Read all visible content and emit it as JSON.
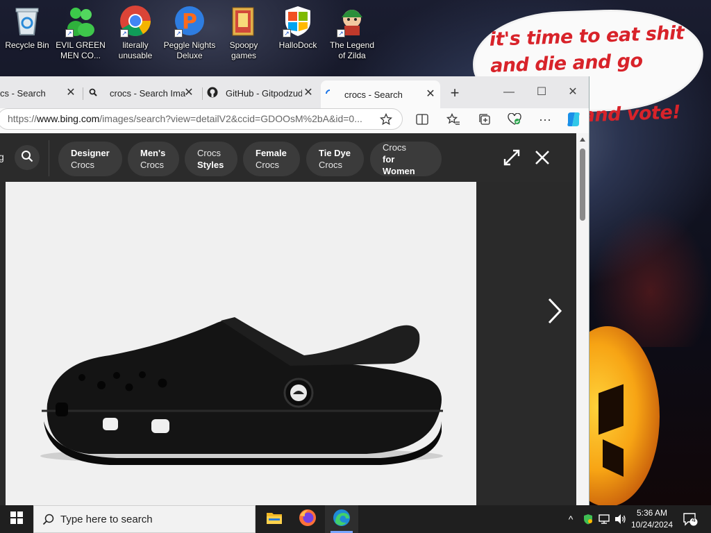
{
  "desktop": {
    "icons": [
      {
        "label": "Recycle Bin",
        "icon": "recycle-bin-icon",
        "shortcut": false
      },
      {
        "label": "EVIL GREEN MEN CO...",
        "icon": "evil-green-men-icon",
        "shortcut": true
      },
      {
        "label": "literally unusable",
        "icon": "chrome-icon",
        "shortcut": true
      },
      {
        "label": "Peggle Nights Deluxe",
        "icon": "peggle-icon",
        "shortcut": true
      },
      {
        "label": "Spoopy games",
        "icon": "folder-icon",
        "shortcut": false
      },
      {
        "label": "HalloDock",
        "icon": "windows-shield-icon",
        "shortcut": true
      },
      {
        "label": "The Legend of Zilda",
        "icon": "zelda-game-icon",
        "shortcut": true
      }
    ],
    "meme_text": [
      "it's time to eat shit",
      "and die and go trick",
      "and vote!"
    ]
  },
  "browser": {
    "tabs": [
      {
        "title": "cs - Search",
        "favicon": "bing-icon",
        "active": false
      },
      {
        "title": "crocs - Search Images",
        "favicon": "search-icon",
        "active": false
      },
      {
        "title": "GitHub - Gitpodzud...",
        "favicon": "github-icon",
        "active": false
      },
      {
        "title": "crocs - Search",
        "favicon": "loading-spinner-icon",
        "active": true
      }
    ],
    "new_tab": "+",
    "window_controls": {
      "minimize": "—",
      "maximize": "☐",
      "close": "✕"
    },
    "url": {
      "prefix": "https://",
      "host": "www.bing.com",
      "path": "/images/search?view=detailV2&ccid=GDOOsM%2bA&id=0..."
    }
  },
  "viewer": {
    "left_label": "g",
    "chips": [
      {
        "line1": "Designer",
        "line2": "Crocs",
        "bold": "line1"
      },
      {
        "line1": "Men's",
        "line2": "Crocs",
        "bold": "line1"
      },
      {
        "line1": "Crocs",
        "line2": "Styles",
        "bold": "line2"
      },
      {
        "line1": "Female",
        "line2": "Crocs",
        "bold": "line1"
      },
      {
        "line1": "Tie Dye",
        "line2": "Crocs",
        "bold": "line1"
      },
      {
        "line1": "Crocs",
        "line2": "for Women",
        "bold": "line2"
      }
    ]
  },
  "taskbar": {
    "search_placeholder": "Type here to search",
    "time": "5:36 AM",
    "date": "10/24/2024",
    "notification_count": "4",
    "apps": [
      "file-explorer-icon",
      "firefox-icon",
      "edge-icon"
    ]
  },
  "colors": {
    "meme_red": "#d8232a",
    "viewer_bg": "#2b2b2b",
    "chip_bg": "#3b3b3b",
    "taskbar_bg": "#1f1f1f"
  }
}
